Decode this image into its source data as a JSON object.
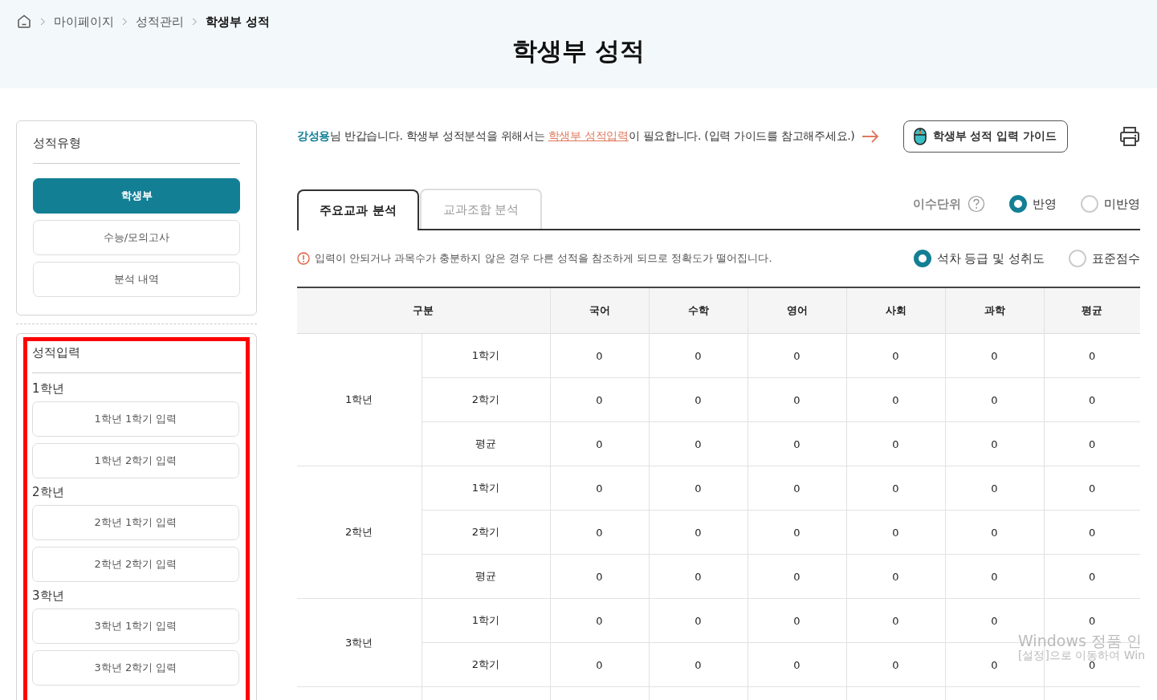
{
  "breadcrumb": [
    "마이페이지",
    "성적관리",
    "학생부 성적"
  ],
  "page_title": "학생부 성적",
  "sidebar": {
    "score_type": {
      "title": "성적유형",
      "items": [
        {
          "label": "학생부",
          "selected": true
        },
        {
          "label": "수능/모의고사",
          "selected": false
        },
        {
          "label": "분석 내역",
          "selected": false
        }
      ]
    },
    "score_input": {
      "title": "성적입력",
      "groups": [
        {
          "label": "1학년",
          "buttons": [
            "1학년 1학기 입력",
            "1학년 2학기 입력"
          ]
        },
        {
          "label": "2학년",
          "buttons": [
            "2학년 1학기 입력",
            "2학년 2학기 입력"
          ]
        },
        {
          "label": "3학년",
          "buttons": [
            "3학년 1학기 입력",
            "3학년 2학기 입력"
          ]
        }
      ]
    }
  },
  "greeting": {
    "name": "강성용",
    "before_link": "님 반갑습니다. 학생부 성적분석을 위해서는 ",
    "link": "학생부 성적입력",
    "after_link": "이 필요합니다. (입력 가이드를 참고해주세요.)"
  },
  "guide_button": "학생부 성적 입력 가이드",
  "tabs": [
    {
      "label": "주요교과 분석",
      "selected": true
    },
    {
      "label": "교과조합 분석",
      "selected": false
    }
  ],
  "credit_units": {
    "label": "이수단위",
    "options": [
      {
        "label": "반영",
        "selected": true
      },
      {
        "label": "미반영",
        "selected": false
      }
    ]
  },
  "notice": "입력이 안되거나 과목수가 충분하지 않은 경우 다른 성적을 참조하게 되므로 정확도가 떨어집니다.",
  "score_basis": {
    "options": [
      {
        "label": "석차 등급 및 성취도",
        "selected": true
      },
      {
        "label": "표준점수",
        "selected": false
      }
    ]
  },
  "table": {
    "columns": [
      "구분",
      "국어",
      "수학",
      "영어",
      "사회",
      "과학",
      "평균"
    ],
    "years": [
      {
        "label": "1학년",
        "rows": [
          {
            "term": "1학기",
            "values": [
              "0",
              "0",
              "0",
              "0",
              "0",
              "0"
            ]
          },
          {
            "term": "2학기",
            "values": [
              "0",
              "0",
              "0",
              "0",
              "0",
              "0"
            ]
          },
          {
            "term": "평균",
            "values": [
              "0",
              "0",
              "0",
              "0",
              "0",
              "0"
            ]
          }
        ]
      },
      {
        "label": "2학년",
        "rows": [
          {
            "term": "1학기",
            "values": [
              "0",
              "0",
              "0",
              "0",
              "0",
              "0"
            ]
          },
          {
            "term": "2학기",
            "values": [
              "0",
              "0",
              "0",
              "0",
              "0",
              "0"
            ]
          },
          {
            "term": "평균",
            "values": [
              "0",
              "0",
              "0",
              "0",
              "0",
              "0"
            ]
          }
        ]
      },
      {
        "label": "3학년",
        "rows": [
          {
            "term": "1학기",
            "values": [
              "0",
              "0",
              "0",
              "0",
              "0",
              "0"
            ]
          },
          {
            "term": "2학기",
            "values": [
              "0",
              "0",
              "0",
              "0",
              "0",
              "0"
            ]
          }
        ]
      }
    ]
  },
  "os_notice": [
    "Windows 정품 인",
    "[설정]으로 이동하여 Win"
  ]
}
